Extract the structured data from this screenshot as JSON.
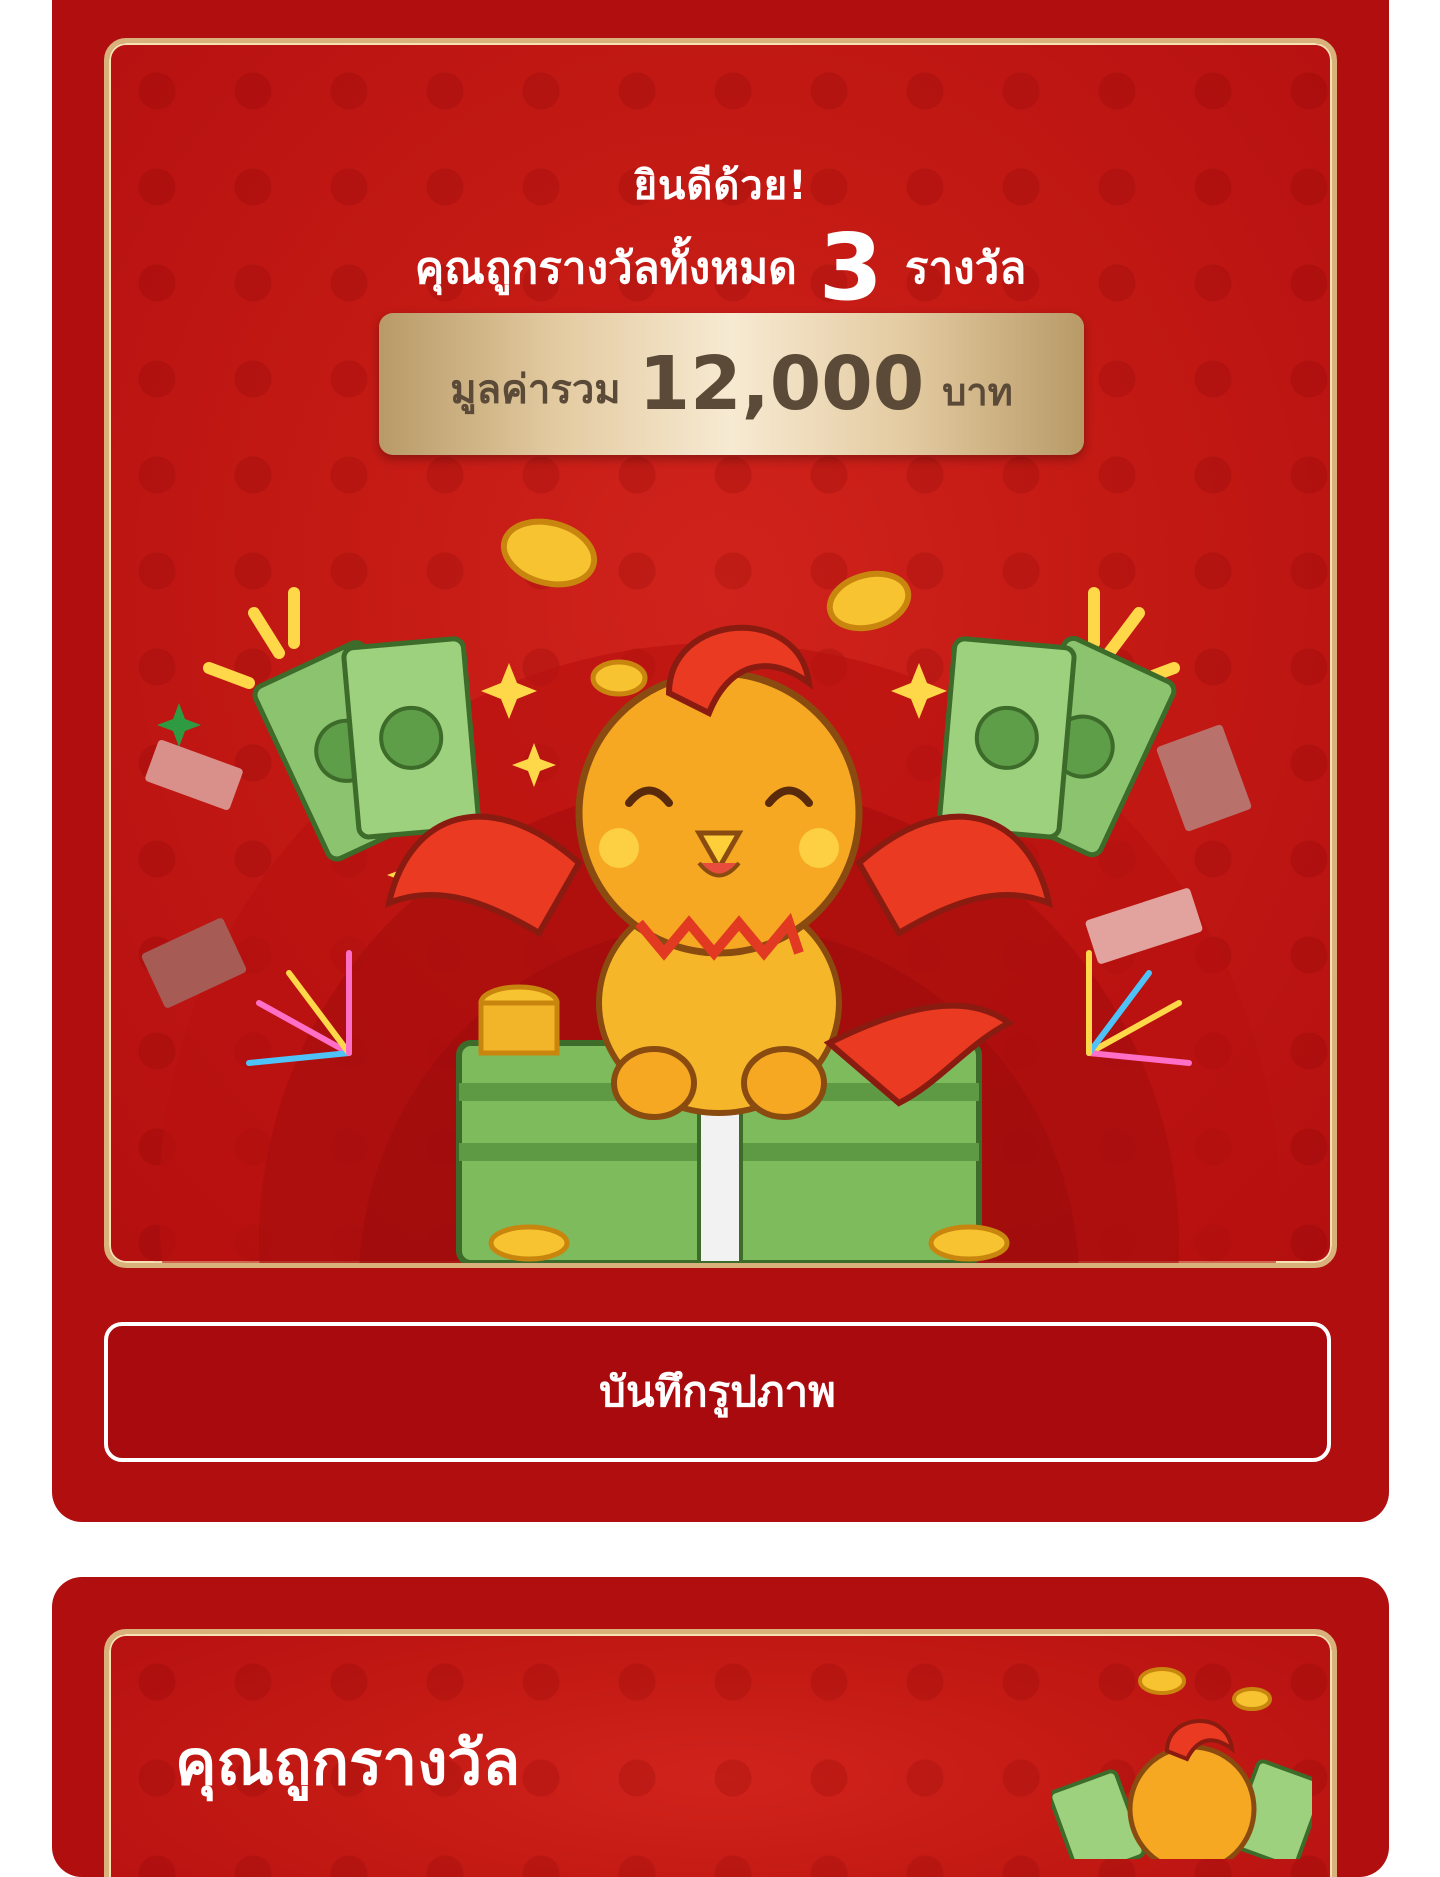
{
  "result_card": {
    "congrats": "ยินดีด้วย!",
    "prize_prefix": "คุณถูกรางวัลทั้งหมด",
    "prize_count": "3",
    "prize_suffix": "รางวัล",
    "value_label": "มูลค่ารวม",
    "value_amount": "12,000",
    "value_unit": "บาท",
    "save_button": "บันทึกรูปภาพ"
  },
  "second_card": {
    "title": "คุณถูกรางวัล"
  },
  "colors": {
    "card_red": "#b10e10",
    "frame_gold": "#d8b27a",
    "value_box_gold": "#e3caa0"
  },
  "illustration": {
    "main": "phoenix-mascot-with-money",
    "mini": "phoenix-mascot-thumbnail"
  }
}
